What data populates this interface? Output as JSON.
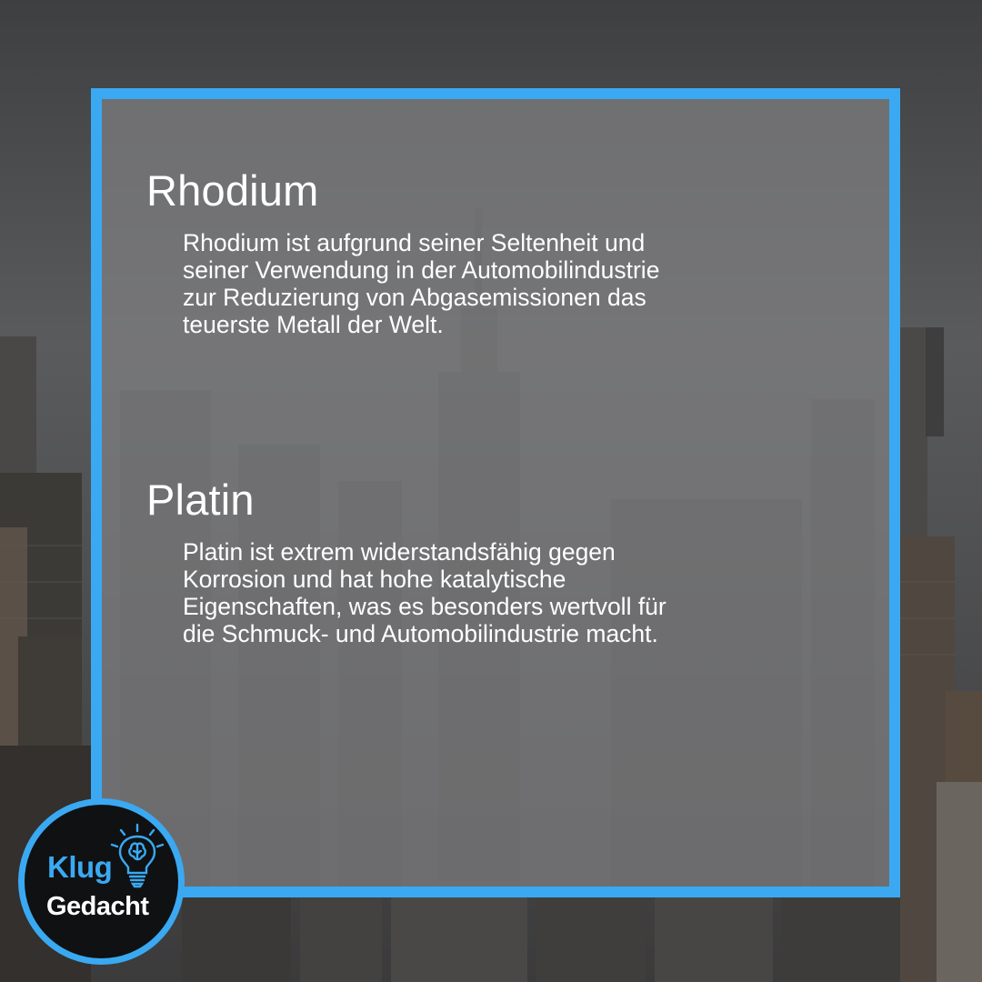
{
  "sections": [
    {
      "title": "Rhodium",
      "body_lines": [
        "Rhodium ist aufgrund seiner Seltenheit und",
        "seiner Verwendung in der Automobilindustrie",
        "zur Reduzierung von Abgasemissionen das",
        "teuerste Metall der Welt."
      ]
    },
    {
      "title": "Platin",
      "body_lines": [
        "Platin ist extrem widerstandsfähig gegen",
        "Korrosion und hat hohe katalytische",
        "Eigenschaften, was es besonders wertvoll für",
        "die Schmuck- und Automobilindustrie macht."
      ]
    }
  ],
  "logo": {
    "word1": "Klug",
    "word2": "Gedacht",
    "icon": "lightbulb-brain-icon"
  },
  "background": {
    "description_icon": "city-skyline-image"
  },
  "colors": {
    "accent": "#3aa9f2",
    "text": "#ffffff",
    "panel": "#808082",
    "logo_bg": "#101113"
  }
}
